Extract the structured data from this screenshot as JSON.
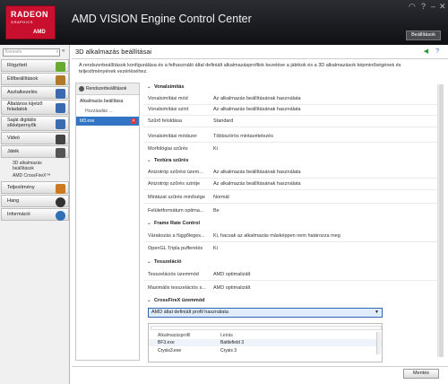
{
  "window": {
    "logo_line1": "RADEON",
    "logo_line2": "GRAPHICS",
    "logo_line3": "AMD",
    "title": "AMD VISION Engine Control Center",
    "preset_label": "Beállítások"
  },
  "sidebar": {
    "search_placeholder": "Keresés",
    "items": [
      {
        "label": "Rögzített",
        "icon": "pin-icon",
        "color": "#66aa33"
      },
      {
        "label": "Előbeállítások",
        "icon": "pencil-icon",
        "color": "#b07a2a"
      },
      {
        "label": "Asztalkezelés",
        "icon": "desktop-icon",
        "color": "#3a6bb0"
      },
      {
        "label": "Általános kijelző feladatok",
        "icon": "display-icon",
        "color": "#3a6bb0"
      },
      {
        "label": "Saját digitális síkképernyők",
        "icon": "flatpanel-icon",
        "color": "#3a6bb0"
      },
      {
        "label": "Videó",
        "icon": "video-icon",
        "color": "#444444"
      },
      {
        "label": "Játék",
        "icon": "gaming-icon",
        "color": "#555555"
      },
      {
        "label": "Teljesítmény",
        "icon": "performance-icon",
        "color": "#cc7a1f"
      },
      {
        "label": "Hang",
        "icon": "audio-icon",
        "color": "#333333"
      },
      {
        "label": "Információ",
        "icon": "info-icon",
        "color": "#2e6fb6"
      }
    ],
    "sub_links": [
      "3D alkalmazás beállítások",
      "AMD CrossFireX™"
    ]
  },
  "main": {
    "page_title": "3D alkalmazás beállításai",
    "description": "A rendszerbeállítások konfigurálása és a felhasználó által definiált alkalmazásprofilok kezelése a játékok és a 3D alkalmazások képminőségének és teljesítményének vezérléséhez.",
    "app_panel": {
      "header": "Rendszerbeállítások",
      "rows": [
        "Alkalmazás beállítása",
        "Hozzáadás ...",
        "bf3.exe"
      ]
    },
    "sections": [
      {
        "title": "Vonalsimítás",
        "rows": [
          {
            "label": "Vonalsimítási mód",
            "value": "Az alkalmazás beállításának használata"
          },
          {
            "label": "Vonalsimítási szint",
            "value": "Az alkalmazás beállításának használata"
          },
          {
            "label": "Szűrő feloldása",
            "value": "Standard"
          },
          {
            "label": "Vonalsimítási módszer",
            "value": "Többszörös mintavételezés"
          },
          {
            "label": "Morfológiai szűrés",
            "value": "Ki"
          }
        ]
      },
      {
        "title": "Textúra szűrés",
        "rows": [
          {
            "label": "Anizotróp szűrési üzem...",
            "value": "Az alkalmazás beállításának használata"
          },
          {
            "label": "Anizotróp szűrés szintje",
            "value": "Az alkalmazás beállításának használata"
          },
          {
            "label": "Mintázat szűrés minősége",
            "value": "Normál"
          },
          {
            "label": "Felületformátum optima...",
            "value": "Be"
          }
        ]
      },
      {
        "title": "Frame Rate Control",
        "rows": [
          {
            "label": "Várakozás a függőleges...",
            "value": "Ki, hacsak az alkalmazás másképpen nem határozza meg"
          },
          {
            "label": "OpenGL Tripla pufferelés",
            "value": "Ki"
          }
        ]
      },
      {
        "title": "Tesszeláció",
        "rows": [
          {
            "label": "Tesszelációs üzemmód",
            "value": "AMD optimalizált"
          },
          {
            "label": "Maximális tesszelációs s...",
            "value": "AMD optimalizált"
          }
        ]
      },
      {
        "title": "CrossFireX üzemmód",
        "rows": []
      }
    ],
    "crossfire": {
      "dropdown_value": "AMD által definiált profil használata",
      "table_headers": [
        "Alkalmazásprofil",
        "Leírás"
      ],
      "table_rows": [
        {
          "profile": "BF3.exe",
          "desc": "Battlefield 3"
        },
        {
          "profile": "Crysis3.exe",
          "desc": "Crysis 3"
        }
      ]
    },
    "default_button": "Mentés"
  }
}
